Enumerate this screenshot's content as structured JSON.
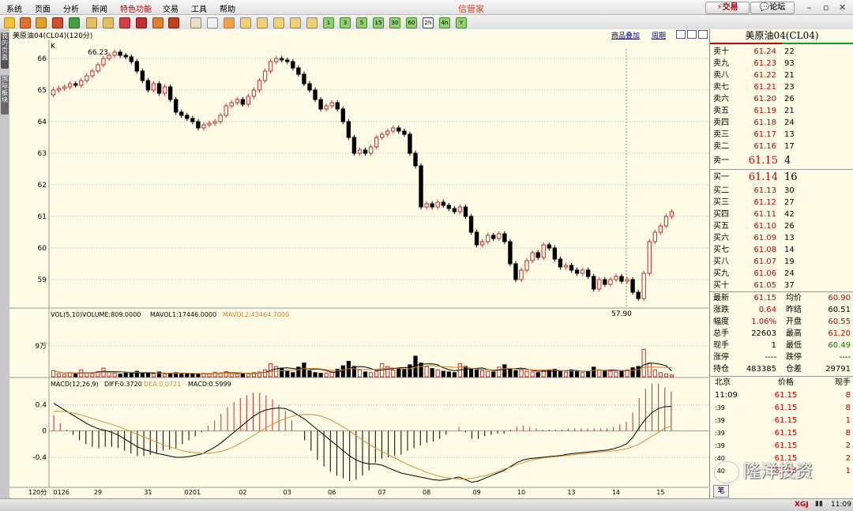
{
  "menu": {
    "items": [
      "系统",
      "页面",
      "分析",
      "新闻",
      "特色功能",
      "交易",
      "工具",
      "帮助"
    ],
    "app_title": "信管家",
    "trade_button": "交易",
    "forum_button": "论坛"
  },
  "toolbar": {
    "period_buttons": [
      "1",
      "3",
      "5",
      "15",
      "30",
      "60",
      "2h",
      "4h",
      "Y"
    ]
  },
  "subheader": {
    "instrument_label": "美原油04(CL04)(120分)",
    "overlay_link": "商品叠加",
    "period_link": "周期"
  },
  "left_tabs": [
    "我的页面",
    "国际板块"
  ],
  "chart_data": [
    {
      "type": "candlestick",
      "title": "美原油04(CL04)(120分)",
      "indicator_label": "K",
      "ylim": [
        58.3,
        66.3
      ],
      "yticks": [
        59,
        60,
        61,
        62,
        63,
        64,
        65,
        66
      ],
      "x_tick_labels": [
        "0126",
        "29",
        "31",
        "0201",
        "02",
        "03",
        "06",
        "07",
        "08",
        "09",
        "10",
        "13",
        "14",
        "15"
      ],
      "x_axis_caption": "120分",
      "annotations": [
        {
          "text": "66.23",
          "value": 66.23
        },
        {
          "text": "57.90",
          "value": 57.9
        }
      ],
      "close": [
        65.0,
        65.05,
        65.1,
        65.2,
        65.15,
        65.3,
        65.45,
        65.6,
        65.8,
        66.0,
        66.1,
        66.2,
        66.1,
        66.05,
        65.9,
        65.6,
        65.3,
        65.0,
        65.2,
        64.9,
        65.1,
        64.7,
        64.3,
        64.2,
        64.1,
        64.0,
        63.8,
        63.9,
        63.95,
        64.0,
        64.2,
        64.5,
        64.6,
        64.7,
        64.55,
        64.8,
        65.0,
        65.3,
        65.6,
        65.9,
        66.0,
        65.95,
        65.9,
        65.7,
        65.5,
        65.2,
        65.0,
        64.7,
        64.4,
        64.5,
        64.6,
        64.4,
        64.0,
        63.5,
        63.0,
        63.1,
        63.0,
        63.2,
        63.5,
        63.6,
        63.7,
        63.8,
        63.7,
        63.6,
        63.0,
        62.6,
        61.3,
        61.4,
        61.3,
        61.45,
        61.35,
        61.25,
        61.15,
        61.3,
        61.0,
        60.5,
        60.1,
        60.2,
        60.4,
        60.3,
        60.45,
        60.2,
        59.5,
        59.0,
        59.3,
        59.6,
        59.85,
        59.7,
        60.1,
        60.0,
        59.65,
        59.4,
        59.45,
        59.3,
        59.2,
        59.3,
        59.1,
        58.7,
        59.0,
        58.85,
        59.0,
        59.1,
        58.95,
        59.0,
        58.6,
        58.4,
        59.2,
        60.2,
        60.5,
        60.7,
        61.0,
        61.15
      ]
    },
    {
      "type": "bar",
      "title": "VOL(5,10)",
      "legend": [
        {
          "name": "VOLUME",
          "text": "VOLUME:809.0000"
        },
        {
          "name": "MAVOL1",
          "text": "MAVOL1:17446.0000"
        },
        {
          "name": "MAVOL2",
          "text": "MAVOL2:43464.7000"
        }
      ],
      "ytick_label": "9万",
      "colors": {
        "up": "#c03030",
        "down": "#000000",
        "mavol1": "#000000",
        "mavol2": "#d08020"
      },
      "values": [
        18000,
        9000,
        7000,
        12000,
        8000,
        20000,
        11000,
        9000,
        15000,
        25000,
        14000,
        10000,
        8000,
        12000,
        9000,
        16000,
        11000,
        10000,
        9000,
        14000,
        8000,
        9000,
        12000,
        10000,
        8000,
        9000,
        7000,
        10000,
        9000,
        13000,
        11000,
        15000,
        9000,
        8000,
        10000,
        9000,
        12000,
        14000,
        20000,
        38000,
        30000,
        25000,
        16000,
        12000,
        28000,
        40000,
        18000,
        12000,
        10000,
        11000,
        14000,
        22000,
        32000,
        45000,
        30000,
        20000,
        14000,
        12000,
        16000,
        38000,
        30000,
        20000,
        26000,
        22000,
        35000,
        60000,
        40000,
        30000,
        24000,
        20000,
        16000,
        14000,
        12000,
        38000,
        30000,
        22000,
        20000,
        18000,
        16000,
        14000,
        28000,
        35000,
        24000,
        18000,
        20000,
        16000,
        14000,
        12000,
        18000,
        20000,
        22000,
        16000,
        14000,
        20000,
        18000,
        12000,
        16000,
        28000,
        20000,
        18000,
        16000,
        14000,
        18000,
        20000,
        26000,
        30000,
        80000,
        40000,
        20000,
        12000,
        8000,
        5000
      ]
    },
    {
      "type": "bar",
      "title": "MACD(12,26,9)",
      "legend": [
        {
          "name": "DIFF",
          "text": "DIFF:0.3720"
        },
        {
          "name": "DEA",
          "text": "DEA:0.0721"
        },
        {
          "name": "MACD",
          "text": "MACD:0.5999"
        }
      ],
      "yticks": [
        -0.4,
        0,
        0.4
      ],
      "ylim": [
        -0.82,
        0.62
      ],
      "colors": {
        "diff": "#000000",
        "dea": "#d09030",
        "positive": "#c03030",
        "negative": "#000000"
      },
      "diff": [
        0.42,
        0.36,
        0.3,
        0.24,
        0.18,
        0.12,
        0.07,
        0.03,
        0.01,
        -0.02,
        -0.06,
        -0.12,
        -0.18,
        -0.24,
        -0.28,
        -0.31,
        -0.34,
        -0.36,
        -0.38,
        -0.4,
        -0.4,
        -0.39,
        -0.37,
        -0.35,
        -0.3,
        -0.25,
        -0.18,
        -0.1,
        -0.02,
        0.06,
        0.14,
        0.22,
        0.28,
        0.32,
        0.34,
        0.35,
        0.34,
        0.3,
        0.24,
        0.18,
        0.1,
        0.02,
        -0.06,
        -0.14,
        -0.22,
        -0.3,
        -0.38,
        -0.44,
        -0.48,
        -0.5,
        -0.5,
        -0.52,
        -0.56,
        -0.6,
        -0.64,
        -0.66,
        -0.68,
        -0.7,
        -0.72,
        -0.74,
        -0.75,
        -0.74,
        -0.72,
        -0.7,
        -0.74,
        -0.78,
        -0.76,
        -0.72,
        -0.68,
        -0.64,
        -0.6,
        -0.54,
        -0.48,
        -0.44,
        -0.42,
        -0.41,
        -0.4,
        -0.39,
        -0.38,
        -0.37,
        -0.35,
        -0.34,
        -0.33,
        -0.32,
        -0.31,
        -0.3,
        -0.29,
        -0.27,
        -0.24,
        -0.2,
        -0.1,
        0.05,
        0.18,
        0.28,
        0.34,
        0.37,
        0.372
      ],
      "dea": [
        0.3,
        0.3,
        0.29,
        0.27,
        0.25,
        0.22,
        0.19,
        0.16,
        0.13,
        0.1,
        0.07,
        0.03,
        -0.01,
        -0.05,
        -0.09,
        -0.13,
        -0.17,
        -0.21,
        -0.24,
        -0.27,
        -0.3,
        -0.32,
        -0.33,
        -0.34,
        -0.34,
        -0.33,
        -0.31,
        -0.28,
        -0.24,
        -0.19,
        -0.13,
        -0.07,
        -0.01,
        0.05,
        0.1,
        0.15,
        0.19,
        0.22,
        0.24,
        0.25,
        0.25,
        0.24,
        0.21,
        0.17,
        0.12,
        0.06,
        0.0,
        -0.07,
        -0.14,
        -0.2,
        -0.26,
        -0.31,
        -0.36,
        -0.41,
        -0.46,
        -0.51,
        -0.55,
        -0.59,
        -0.63,
        -0.66,
        -0.69,
        -0.71,
        -0.72,
        -0.73,
        -0.73,
        -0.72,
        -0.7,
        -0.68,
        -0.65,
        -0.62,
        -0.58,
        -0.55,
        -0.51,
        -0.48,
        -0.45,
        -0.43,
        -0.41,
        -0.4,
        -0.39,
        -0.38,
        -0.37,
        -0.36,
        -0.35,
        -0.34,
        -0.33,
        -0.32,
        -0.31,
        -0.3,
        -0.29,
        -0.27,
        -0.24,
        -0.2,
        -0.14,
        -0.08,
        -0.02,
        0.04,
        0.0721
      ]
    }
  ],
  "quote_panel": {
    "title": "美原油04(CL04)",
    "asks": [
      {
        "label": "卖十",
        "price": "61.24",
        "vol": "22"
      },
      {
        "label": "卖九",
        "price": "61.23",
        "vol": "93"
      },
      {
        "label": "卖八",
        "price": "61.22",
        "vol": "21"
      },
      {
        "label": "卖七",
        "price": "61.21",
        "vol": "23"
      },
      {
        "label": "卖六",
        "price": "61.20",
        "vol": "26"
      },
      {
        "label": "卖五",
        "price": "61.19",
        "vol": "21"
      },
      {
        "label": "卖四",
        "price": "61.18",
        "vol": "24"
      },
      {
        "label": "卖三",
        "price": "61.17",
        "vol": "13"
      },
      {
        "label": "卖二",
        "price": "61.16",
        "vol": "17"
      }
    ],
    "ask1": {
      "label": "卖一",
      "price": "61.15",
      "vol": "4"
    },
    "bid1": {
      "label": "买一",
      "price": "61.14",
      "vol": "16"
    },
    "bids": [
      {
        "label": "买二",
        "price": "61.13",
        "vol": "30"
      },
      {
        "label": "买三",
        "price": "61.12",
        "vol": "27"
      },
      {
        "label": "买四",
        "price": "61.11",
        "vol": "42"
      },
      {
        "label": "买五",
        "price": "61.10",
        "vol": "26"
      },
      {
        "label": "买六",
        "price": "61.09",
        "vol": "13"
      },
      {
        "label": "买七",
        "price": "61.08",
        "vol": "14"
      },
      {
        "label": "买八",
        "price": "61.07",
        "vol": "19"
      },
      {
        "label": "买九",
        "price": "61.06",
        "vol": "24"
      },
      {
        "label": "买十",
        "price": "61.05",
        "vol": "37"
      }
    ],
    "stats": [
      {
        "k1": "最新",
        "v1": "61.15",
        "c1": "red",
        "k2": "均价",
        "v2": "60.90",
        "c2": "red"
      },
      {
        "k1": "涨跌",
        "v1": "0.64",
        "c1": "red",
        "k2": "昨结",
        "v2": "60.51",
        "c2": ""
      },
      {
        "k1": "幅度",
        "v1": "1.06%",
        "c1": "red",
        "k2": "开盘",
        "v2": "60.55",
        "c2": "red"
      },
      {
        "k1": "总手",
        "v1": "22603",
        "c1": "",
        "k2": "最高",
        "v2": "61.20",
        "c2": "red"
      },
      {
        "k1": "现手",
        "v1": "1",
        "c1": "",
        "k2": "最低",
        "v2": "60.49",
        "c2": "green"
      },
      {
        "k1": "涨停",
        "v1": "----",
        "c1": "",
        "k2": "跌停",
        "v2": "----",
        "c2": ""
      },
      {
        "k1": "持仓",
        "v1": "483385",
        "c1": "",
        "k2": "仓差",
        "v2": "29791",
        "c2": ""
      }
    ],
    "ticks_header": {
      "place": "北京",
      "price": "价格",
      "vol": "现手"
    },
    "ticks": [
      {
        "time": "11:09",
        "price": "61.15",
        "vol": "8"
      },
      {
        "time": ":39",
        "price": "61.15",
        "vol": "8"
      },
      {
        "time": ":39",
        "price": "61.15",
        "vol": "1"
      },
      {
        "time": ":39",
        "price": "61.15",
        "vol": "8"
      },
      {
        "time": ":39",
        "price": "61.15",
        "vol": "2"
      },
      {
        "time": ":40",
        "price": "61.15",
        "vol": "2"
      },
      {
        "time": ":40",
        "price": "61.15",
        "vol": "1"
      }
    ],
    "bottom_tab": "笔"
  },
  "watermark": "隆洋投资",
  "status": {
    "brand": "XGJ",
    "clock": "11:09"
  }
}
